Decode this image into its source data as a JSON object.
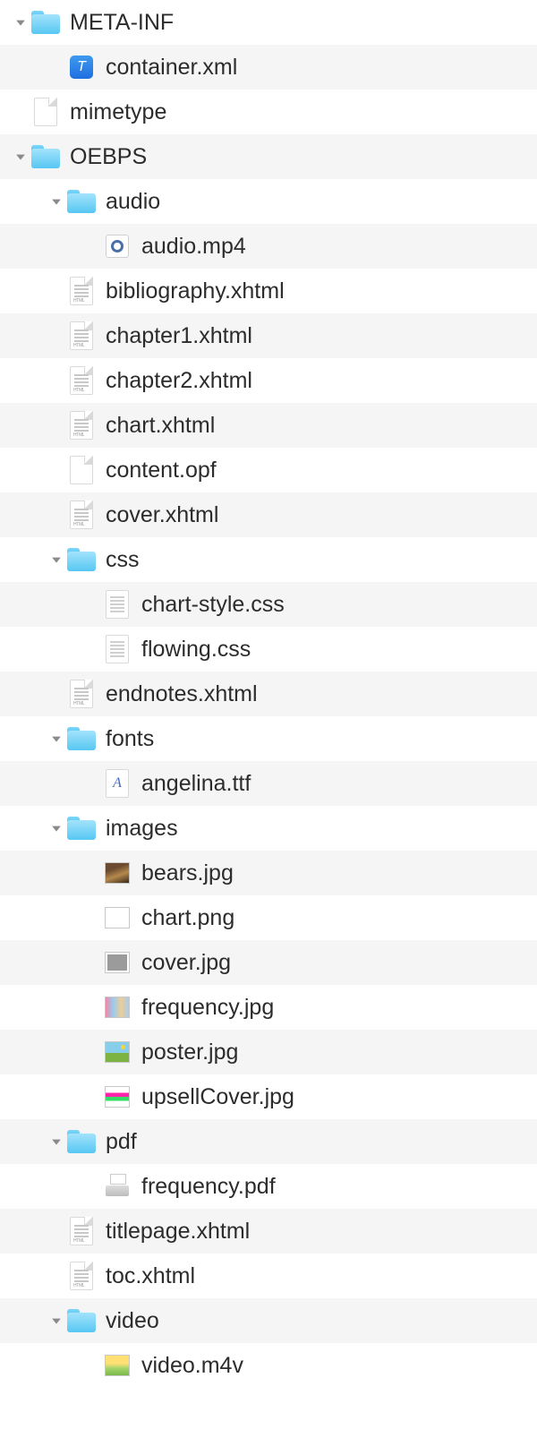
{
  "rows": [
    {
      "level": 0,
      "expanded": true,
      "icon": "folder",
      "name": "meta-inf-folder",
      "label": "META-INF"
    },
    {
      "level": 1,
      "expanded": null,
      "icon": "xml-square",
      "name": "container-xml-file",
      "label": "container.xml"
    },
    {
      "level": 0,
      "expanded": null,
      "icon": "file-blank",
      "name": "mimetype-file",
      "label": "mimetype"
    },
    {
      "level": 0,
      "expanded": true,
      "icon": "folder",
      "name": "oebps-folder",
      "label": "OEBPS"
    },
    {
      "level": 1,
      "expanded": true,
      "icon": "folder",
      "name": "audio-folder",
      "label": "audio"
    },
    {
      "level": 2,
      "expanded": null,
      "icon": "quicktime",
      "name": "audio-mp4-file",
      "label": "audio.mp4"
    },
    {
      "level": 1,
      "expanded": null,
      "icon": "file-xhtml",
      "name": "bibliography-file",
      "label": "bibliography.xhtml"
    },
    {
      "level": 1,
      "expanded": null,
      "icon": "file-xhtml",
      "name": "chapter1-file",
      "label": "chapter1.xhtml"
    },
    {
      "level": 1,
      "expanded": null,
      "icon": "file-xhtml",
      "name": "chapter2-file",
      "label": "chapter2.xhtml"
    },
    {
      "level": 1,
      "expanded": null,
      "icon": "file-xhtml",
      "name": "chart-xhtml-file",
      "label": "chart.xhtml"
    },
    {
      "level": 1,
      "expanded": null,
      "icon": "file-blank",
      "name": "content-opf-file",
      "label": "content.opf"
    },
    {
      "level": 1,
      "expanded": null,
      "icon": "file-xhtml",
      "name": "cover-xhtml-file",
      "label": "cover.xhtml"
    },
    {
      "level": 1,
      "expanded": true,
      "icon": "folder",
      "name": "css-folder",
      "label": "css"
    },
    {
      "level": 2,
      "expanded": null,
      "icon": "file-text",
      "name": "chart-style-css-file",
      "label": "chart-style.css"
    },
    {
      "level": 2,
      "expanded": null,
      "icon": "file-text",
      "name": "flowing-css-file",
      "label": "flowing.css"
    },
    {
      "level": 1,
      "expanded": null,
      "icon": "file-xhtml",
      "name": "endnotes-file",
      "label": "endnotes.xhtml"
    },
    {
      "level": 1,
      "expanded": true,
      "icon": "folder",
      "name": "fonts-folder",
      "label": "fonts"
    },
    {
      "level": 2,
      "expanded": null,
      "icon": "font",
      "name": "angelina-ttf-file",
      "label": "angelina.ttf"
    },
    {
      "level": 1,
      "expanded": true,
      "icon": "folder",
      "name": "images-folder",
      "label": "images"
    },
    {
      "level": 2,
      "expanded": null,
      "icon": "thumb-bears",
      "name": "bears-jpg-file",
      "label": "bears.jpg"
    },
    {
      "level": 2,
      "expanded": null,
      "icon": "thumb-chart",
      "name": "chart-png-file",
      "label": "chart.png"
    },
    {
      "level": 2,
      "expanded": null,
      "icon": "thumb-cover",
      "name": "cover-jpg-file",
      "label": "cover.jpg"
    },
    {
      "level": 2,
      "expanded": null,
      "icon": "thumb-freq",
      "name": "frequency-jpg-file",
      "label": "frequency.jpg"
    },
    {
      "level": 2,
      "expanded": null,
      "icon": "thumb-poster",
      "name": "poster-jpg-file",
      "label": "poster.jpg"
    },
    {
      "level": 2,
      "expanded": null,
      "icon": "thumb-upsell",
      "name": "upsellcover-jpg-file",
      "label": "upsellCover.jpg"
    },
    {
      "level": 1,
      "expanded": true,
      "icon": "folder",
      "name": "pdf-folder",
      "label": "pdf"
    },
    {
      "level": 2,
      "expanded": null,
      "icon": "pdf",
      "name": "frequency-pdf-file",
      "label": "frequency.pdf"
    },
    {
      "level": 1,
      "expanded": null,
      "icon": "file-xhtml",
      "name": "titlepage-file",
      "label": "titlepage.xhtml"
    },
    {
      "level": 1,
      "expanded": null,
      "icon": "file-xhtml",
      "name": "toc-file",
      "label": "toc.xhtml"
    },
    {
      "level": 1,
      "expanded": true,
      "icon": "folder",
      "name": "video-folder",
      "label": "video"
    },
    {
      "level": 2,
      "expanded": null,
      "icon": "thumb-video",
      "name": "video-m4v-file",
      "label": "video.m4v"
    }
  ]
}
